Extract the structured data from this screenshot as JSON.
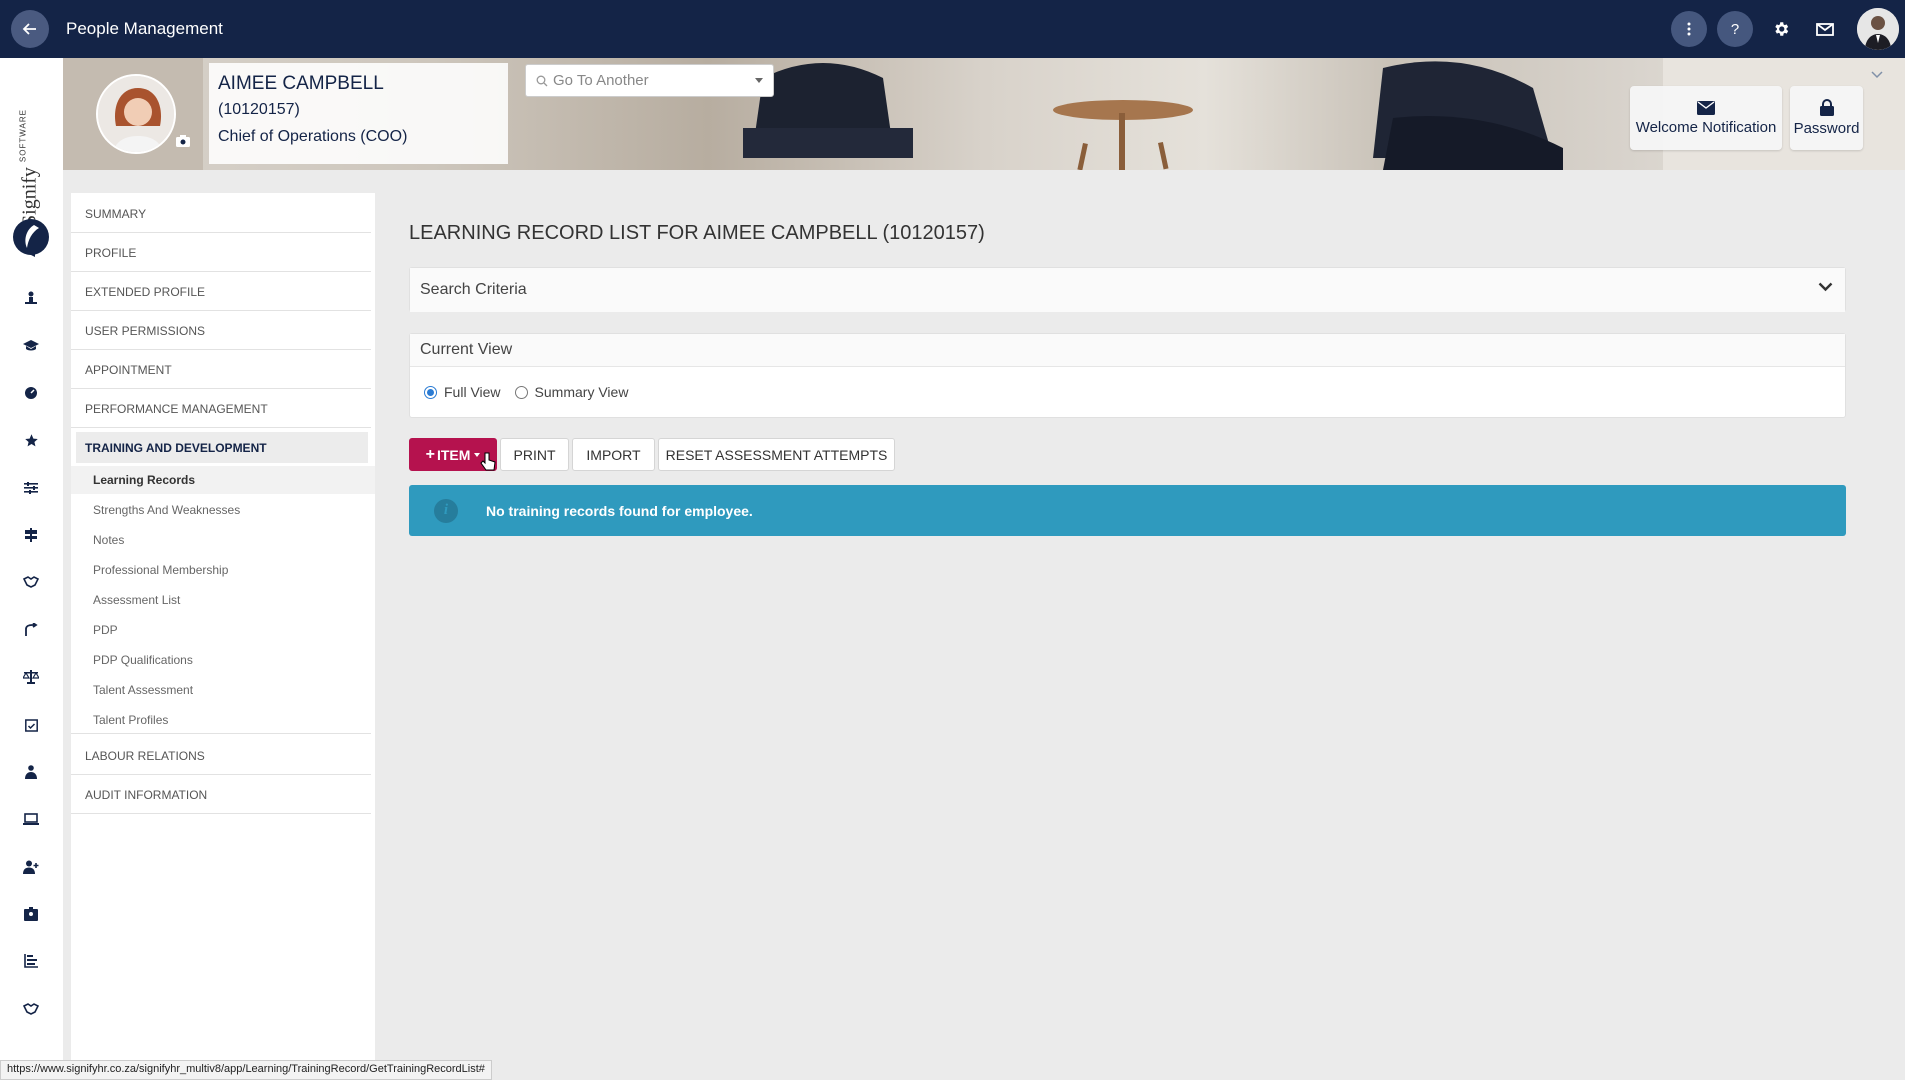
{
  "app": {
    "title": "People Management",
    "back_icon": "arrow-left-icon"
  },
  "topbar": {
    "icons": [
      "more-vertical-icon",
      "help-icon",
      "gear-icon",
      "mail-icon",
      "user-avatar"
    ]
  },
  "employee": {
    "name": "AIMEE CAMPBELL",
    "id": "(10120157)",
    "position": "Chief of Operations (COO)"
  },
  "goto": {
    "placeholder": "Go To Another"
  },
  "banner_buttons": {
    "welcome": "Welcome Notification",
    "password": "Password"
  },
  "sidenav": {
    "items": [
      {
        "label": "SUMMARY"
      },
      {
        "label": "PROFILE"
      },
      {
        "label": "EXTENDED PROFILE"
      },
      {
        "label": "USER PERMISSIONS"
      },
      {
        "label": "APPOINTMENT"
      },
      {
        "label": "PERFORMANCE MANAGEMENT"
      },
      {
        "label": "TRAINING AND DEVELOPMENT"
      }
    ],
    "sub_items": [
      {
        "label": "Learning Records"
      },
      {
        "label": "Strengths And Weaknesses"
      },
      {
        "label": "Notes"
      },
      {
        "label": "Professional Membership"
      },
      {
        "label": "Assessment List"
      },
      {
        "label": "PDP"
      },
      {
        "label": "PDP Qualifications"
      },
      {
        "label": "Talent Assessment"
      },
      {
        "label": "Talent Profiles"
      }
    ],
    "bottom_items": [
      {
        "label": "LABOUR RELATIONS"
      },
      {
        "label": "AUDIT INFORMATION"
      }
    ]
  },
  "main": {
    "title": "LEARNING RECORD LIST FOR AIMEE CAMPBELL (10120157)",
    "search_criteria": "Search Criteria",
    "current_view": "Current View",
    "full_view": "Full View",
    "summary_view": "Summary View",
    "buttons": {
      "item": "ITEM",
      "print": "PRINT",
      "import": "IMPORT",
      "reset": "RESET ASSESSMENT ATTEMPTS"
    },
    "alert": "No training records found for employee."
  },
  "status_url": "https://www.signifyhr.co.za/signifyhr_multiv8/app/Learning/TrainingRecord/GetTrainingRecordList#",
  "logo_text": "Signify",
  "logo_sub": "SOFTWARE",
  "colors": {
    "topbar": "#142447",
    "primary_button": "#b5124e",
    "alert": "#2f9abe"
  }
}
